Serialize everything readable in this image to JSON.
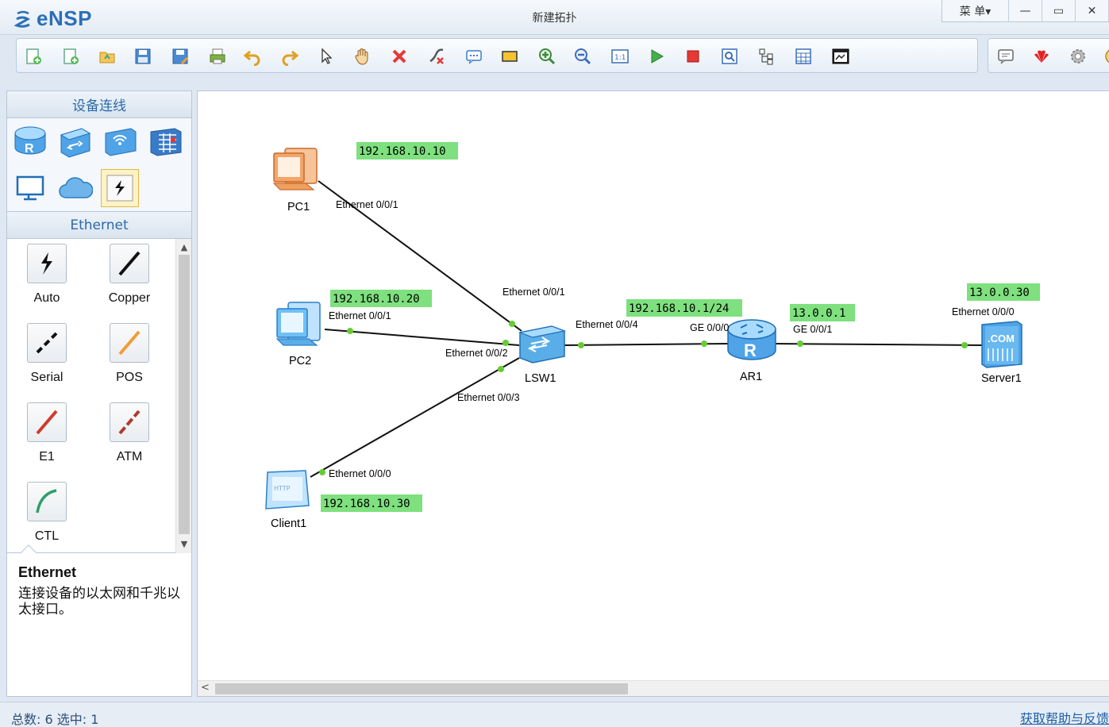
{
  "app": {
    "logo_text": "eNSP",
    "window_title": "新建拓扑",
    "menu_label": "菜 单▾",
    "min_glyph": "—",
    "max_glyph": "▭",
    "close_glyph": "✕"
  },
  "toolbar": {
    "icons": [
      "new-topology-icon",
      "new-lab-icon",
      "open-icon",
      "save-icon",
      "save-as-icon",
      "print-icon",
      "undo-icon",
      "redo-icon",
      "select-icon",
      "pan-hand-icon",
      "delete-icon",
      "delete-link-icon",
      "text-note-icon",
      "rectangle-icon",
      "zoom-in-icon",
      "zoom-out-icon",
      "fit-view-icon",
      "start-device-icon",
      "stop-device-icon",
      "capture-icon",
      "topology-tree-icon",
      "table-icon",
      "terminal-icon"
    ],
    "right_icons": [
      "feedback-icon",
      "huawei-logo-icon",
      "settings-gear-icon",
      "help-icon"
    ]
  },
  "left_panel": {
    "device_header": "设备连线",
    "devices": [
      "router-icon",
      "switch-icon",
      "wireless-icon",
      "firewall-icon",
      "pc-terminal-icon",
      "cloud-icon",
      "cable-icon"
    ],
    "cable_header": "Ethernet",
    "cables": [
      {
        "label": "Auto",
        "icon": "auto-cable-icon"
      },
      {
        "label": "Copper",
        "icon": "copper-cable-icon"
      },
      {
        "label": "Serial",
        "icon": "serial-cable-icon"
      },
      {
        "label": "POS",
        "icon": "pos-cable-icon"
      },
      {
        "label": "E1",
        "icon": "e1-cable-icon"
      },
      {
        "label": "ATM",
        "icon": "atm-cable-icon"
      },
      {
        "label": "CTL",
        "icon": "ctl-cable-icon"
      }
    ],
    "desc_title": "Ethernet",
    "desc_text": "连接设备的以太网和千兆以太接口。"
  },
  "topology": {
    "nodes": {
      "pc1": "PC1",
      "pc2": "PC2",
      "client1": "Client1",
      "lsw1": "LSW1",
      "ar1": "AR1",
      "server1": "Server1"
    },
    "ip_labels": {
      "pc1": "192.168.10.10",
      "pc2": "192.168.10.20",
      "client1": "192.168.10.30",
      "ar1_ge0": "192.168.10.1/24",
      "ar1_ge1": "13.0.0.1",
      "server1": "13.0.0.30"
    },
    "ports": {
      "pc1_eth": "Ethernet 0/0/1",
      "lsw_eth1": "Ethernet 0/0/1",
      "pc2_eth": "Ethernet 0/0/1",
      "lsw_eth2": "Ethernet 0/0/2",
      "lsw_eth3": "Ethernet 0/0/3",
      "client_eth": "Ethernet 0/0/0",
      "lsw_eth4": "Ethernet 0/0/4",
      "ar_ge0": "GE 0/0/0",
      "ar_ge1": "GE 0/0/1",
      "server_eth": "Ethernet 0/0/0"
    },
    "colors": {
      "ip_label_bg": "#7ee07e",
      "link": "#111111",
      "port_dot": "#66cc33"
    }
  },
  "status": {
    "text": "总数:  6  选中:  1",
    "help": "获取帮助与反馈"
  }
}
